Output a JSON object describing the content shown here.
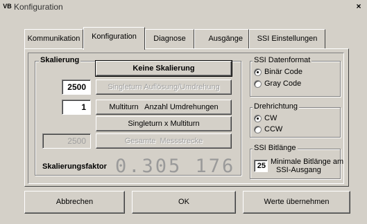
{
  "window": {
    "title": "Konfiguration",
    "icon": "VB",
    "close": "×"
  },
  "tabs": [
    {
      "label": "Kommunikation",
      "active": false
    },
    {
      "label": "Konfiguration",
      "active": true
    },
    {
      "label": "Diagnose",
      "active": false
    },
    {
      "label": "Ausgänge",
      "active": false
    },
    {
      "label": "SSI Einstellungen",
      "active": false
    }
  ],
  "skalierung": {
    "legend": "Skalierung",
    "keine_button": "Keine Skalierung",
    "singleturn_value": "2500",
    "singleturn_button": "Singleturn Auflösung/Umdrehung",
    "multiturn_value": "1",
    "multiturn_button": "Multiturn   Anzahl Umdrehungen",
    "product_button": "Singleturn x Multiturn",
    "total_value": "2500",
    "total_button": "Gesamte  Messstrecke",
    "factor_label": "Skalierungsfaktor",
    "factor_value": "0.305 176"
  },
  "ssi_format": {
    "legend": "SSI Datenformat",
    "options": [
      {
        "label": "Binär Code",
        "checked": true
      },
      {
        "label": "Gray Code",
        "checked": false
      }
    ]
  },
  "drehrichtung": {
    "legend": "Drehrichtung",
    "options": [
      {
        "label": "CW",
        "checked": true
      },
      {
        "label": "CCW",
        "checked": false
      }
    ]
  },
  "ssi_bitlaenge": {
    "legend": "SSI Bitlänge",
    "value": "25",
    "description_line1": "Minimale Bitlänge am",
    "description_line2": "SSI-Ausgang"
  },
  "footer": {
    "cancel": "Abbrechen",
    "ok": "OK",
    "apply": "Werte übernehmen"
  }
}
